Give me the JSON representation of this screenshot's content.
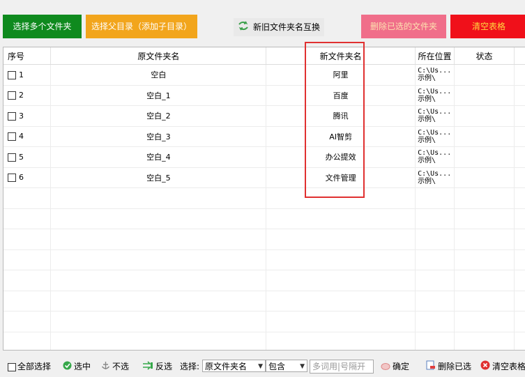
{
  "toolbar": {
    "select_multi_folders": "选择多个文件夹",
    "select_parent_dir": "选择父目录（添加子目录）",
    "swap_names": "新旧文件夹名互换",
    "delete_selected": "删除已选的文件夹",
    "clear_table": "清空表格"
  },
  "table": {
    "headers": [
      "序号",
      "原文件夹名",
      "新文件夹名",
      "所在位置",
      "状态"
    ],
    "rows": [
      {
        "seq": "1",
        "old": "空白",
        "new": "阿里",
        "loc1": "C:\\Us...",
        "loc2": "示例\\",
        "status": ""
      },
      {
        "seq": "2",
        "old": "空白_1",
        "new": "百度",
        "loc1": "C:\\Us...",
        "loc2": "示例\\",
        "status": ""
      },
      {
        "seq": "3",
        "old": "空白_2",
        "new": "腾讯",
        "loc1": "C:\\Us...",
        "loc2": "示例\\",
        "status": ""
      },
      {
        "seq": "4",
        "old": "空白_3",
        "new": "AI智剪",
        "loc1": "C:\\Us...",
        "loc2": "示例\\",
        "status": ""
      },
      {
        "seq": "5",
        "old": "空白_4",
        "new": "办公提效",
        "loc1": "C:\\Us...",
        "loc2": "示例\\",
        "status": ""
      },
      {
        "seq": "6",
        "old": "空白_5",
        "new": "文件管理",
        "loc1": "C:\\Us...",
        "loc2": "示例\\",
        "status": ""
      }
    ]
  },
  "bottom": {
    "select_all": "全部选择",
    "check": "选中",
    "uncheck": "不选",
    "invert": "反选",
    "select_label": "选择:",
    "field_value": "原文件夹名",
    "match_value": "包含",
    "keyword_placeholder": "多词用|号隔开",
    "confirm": "确定",
    "delete_selected": "删除已选",
    "clear_table": "清空表格"
  },
  "colors": {
    "green": "#0f8a1e",
    "orange": "#f2a51c",
    "pink": "#f06e8a",
    "red": "#f0101a",
    "highlight": "#e03030"
  }
}
